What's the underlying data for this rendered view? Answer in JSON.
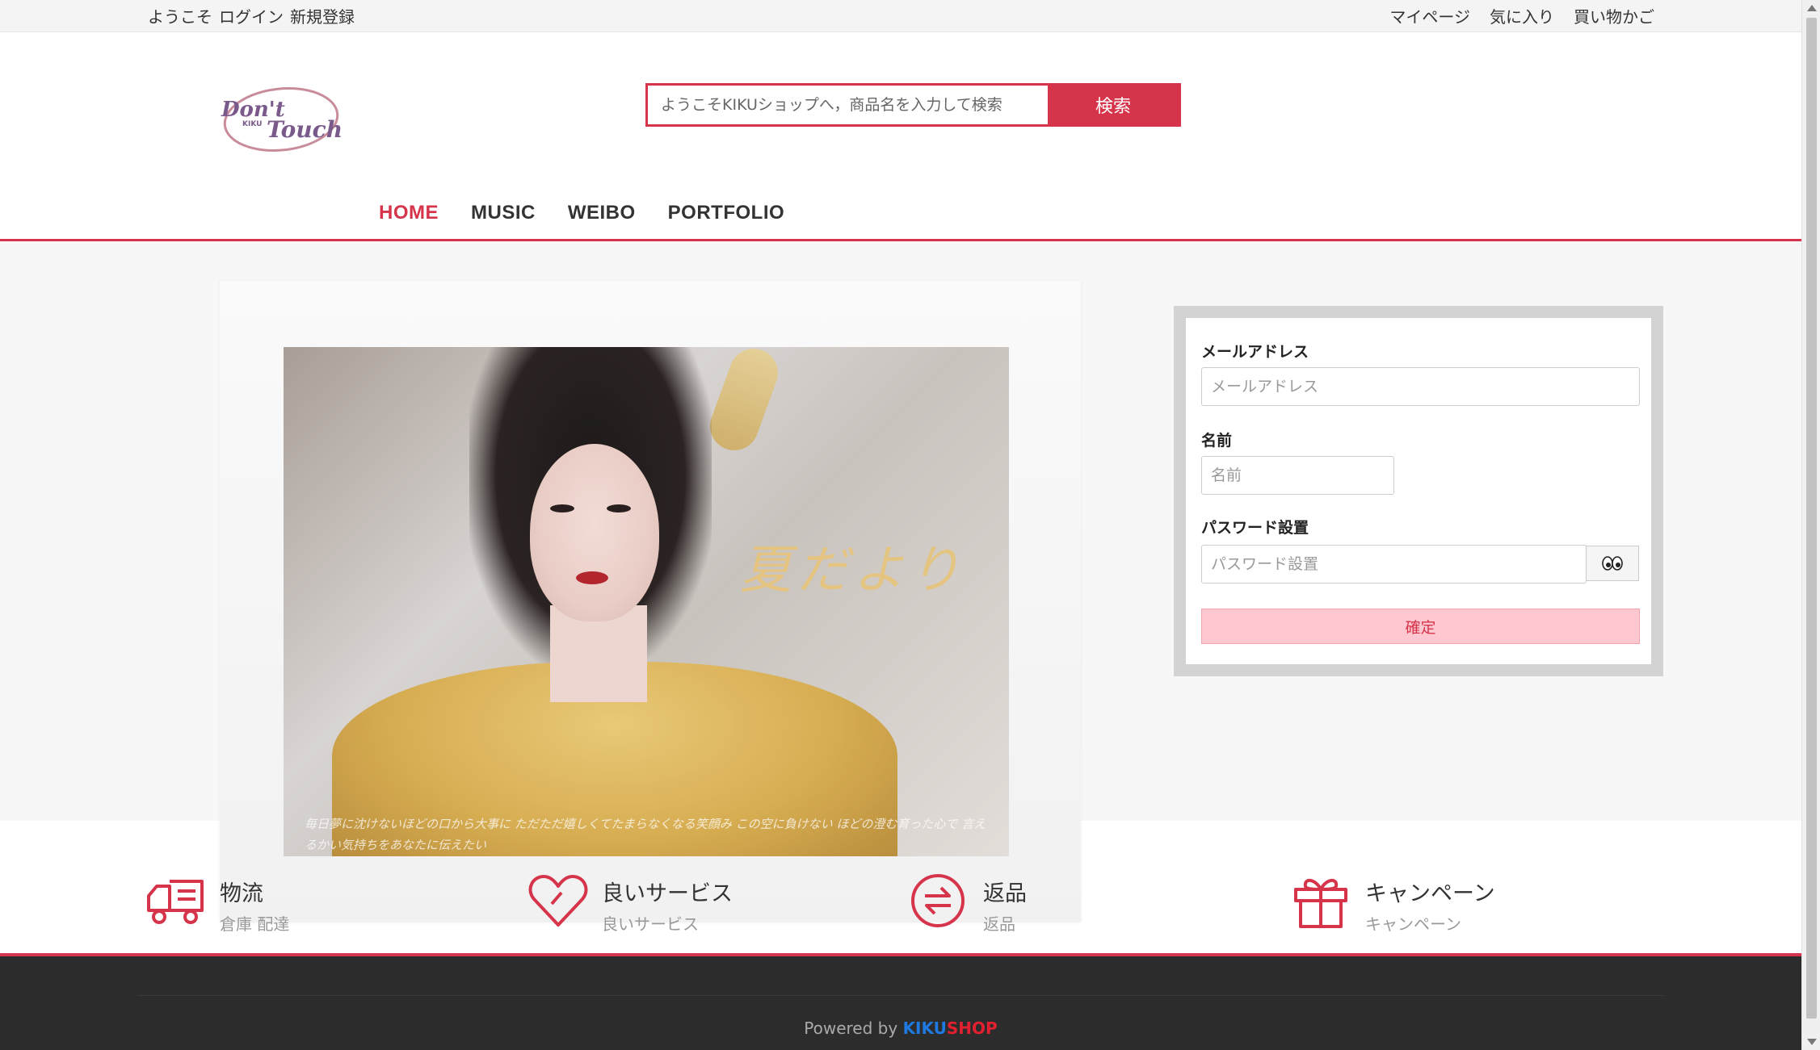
{
  "topbar": {
    "welcome": "ようこそ",
    "login": "ログイン",
    "register": "新規登録",
    "mypage": "マイページ",
    "favorites": "気に入り",
    "cart": "買い物かご"
  },
  "logo": {
    "main_text": "Don't Touch",
    "sub_text": "KIKU"
  },
  "search": {
    "placeholder": "ようこそKIKUショップへ，商品名を入力して検索",
    "button_label": "検索"
  },
  "nav": {
    "items": [
      {
        "label": "HOME",
        "active": true
      },
      {
        "label": "MUSIC",
        "active": false
      },
      {
        "label": "WEIBO",
        "active": false
      },
      {
        "label": "PORTFOLIO",
        "active": false
      }
    ]
  },
  "banner": {
    "title": "夏だより",
    "caption": "毎日夢に沈けないほどの口から大事に ただただ嬉しくてたまらなくなる笑顔み この空に負けない ほどの澄む育った心で 言えるかい気持ちをあなたに伝えたい"
  },
  "form": {
    "email_label": "メールアドレス",
    "email_placeholder": "メールアドレス",
    "name_label": "名前",
    "name_placeholder": "名前",
    "password_label": "パスワード設置",
    "password_placeholder": "パスワード設置",
    "submit_label": "確定"
  },
  "features": [
    {
      "title": "物流",
      "subtitle": "倉庫 配達",
      "icon": "truck-icon"
    },
    {
      "title": "良いサービス",
      "subtitle": "良いサービス",
      "icon": "heart-icon"
    },
    {
      "title": "返品",
      "subtitle": "返品",
      "icon": "return-icon"
    },
    {
      "title": "キャンペーン",
      "subtitle": "キャンペーン",
      "icon": "gift-icon"
    }
  ],
  "footer": {
    "powered_by": "Powered by",
    "brand_part1": "KIKU",
    "brand_part2": "SHOP"
  },
  "colors": {
    "accent": "#d6344b",
    "submit_bg": "#ffc7cf",
    "footer_bg": "#2c2c2c",
    "brand_blue": "#1e7ae0",
    "brand_red": "#e2202f"
  }
}
